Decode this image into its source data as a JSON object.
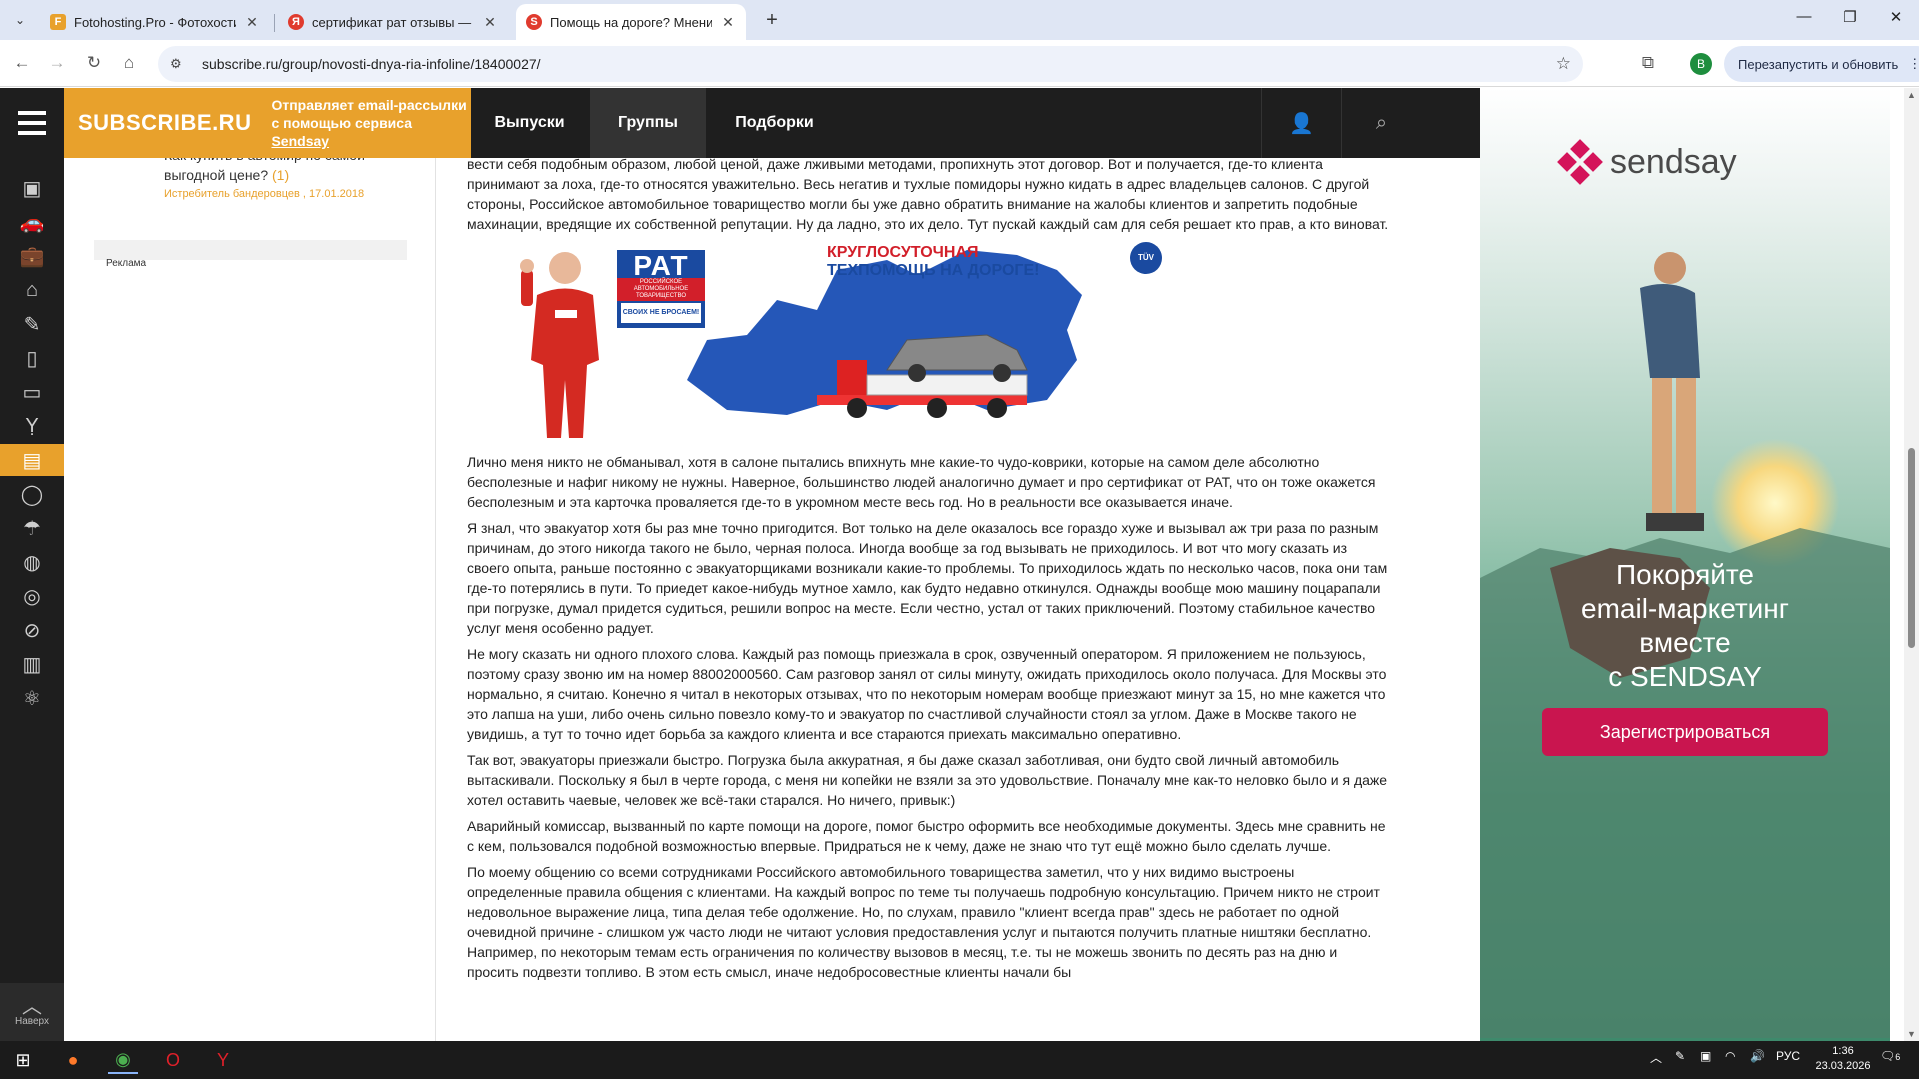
{
  "browser": {
    "tabs": [
      {
        "title": "Fotohosting.Pro - Фотохостинг",
        "favicon": "F",
        "color": "#e8a12c"
      },
      {
        "title": "сертификат рат отзывы — Янд",
        "favicon": "Я",
        "color": "#e03b2e"
      },
      {
        "title": "Помощь на дороге? Мнение п",
        "favicon": "S",
        "color": "#e03b2e"
      }
    ],
    "url": "subscribe.ru/group/novosti-dnya-ria-infoline/18400027/",
    "profile_initial": "В",
    "relaunch_label": "Перезапустить и обновить"
  },
  "site": {
    "brand": "SUBSCRIBE.RU",
    "tagline_1": "Отправляет email-рассылки",
    "tagline_2": "с помощью сервиса",
    "tagline_link": "Sendsay",
    "nav": [
      "Выпуски",
      "Группы",
      "Подборки"
    ],
    "scroll_top_label": "Наверх"
  },
  "left_column": {
    "question": "Как купить в автомир по самой выгодной цене?",
    "count": "(1)",
    "meta": "Истребитель бандеровцев , 17.01.2018",
    "ad_label": "Реклама"
  },
  "article": {
    "p0": "вести себя подобным образом, любой ценой, даже лживыми методами, пропихнуть этот договор. Вот и получается, где-то клиента принимают за лоха, где-то относятся уважительно. Весь негатив и тухлые помидоры нужно кидать в адрес владельцев салонов. С другой стороны, Российское автомобильное товарищество могли бы уже давно обратить внимание на жалобы клиентов и запретить подобные махинации, вредящие их собственной репутации. Ну да ладно, это их дело. Тут пускай каждый сам для себя решает кто прав, а кто виноват.",
    "banner": {
      "rat": "РАТ",
      "rat_sub": "РОССИЙСКОЕ АВТОМОБИЛЬНОЕ ТОВАРИЩЕСТВО",
      "slogan": "СВОИХ НЕ БРОСАЕМ!",
      "headline_1": "КРУГЛОСУТОЧНАЯ",
      "headline_2": "ТЕХПОМОЩЬ НА ДОРОГЕ!",
      "tuv": "TÜV"
    },
    "p1": "Лично меня никто не обманывал, хотя в салоне пытались впихнуть мне какие-то чудо-коврики, которые на самом деле абсолютно бесполезные и нафиг никому не нужны. Наверное, большинство людей аналогично думает и про сертификат от РАТ, что он тоже окажется бесполезным и эта карточка проваляется где-то в укромном месте весь год. Но в реальности все оказывается иначе.",
    "p2": "Я знал, что эвакуатор хотя бы раз мне точно пригодится. Вот только на деле оказалось все гораздо хуже и вызывал аж три раза по разным причинам, до этого никогда такого не было, черная полоса. Иногда вообще за год вызывать не приходилось. И вот что могу сказать из своего опыта, раньше постоянно с эвакуаторщиками возникали какие-то проблемы. То приходилось ждать по несколько часов, пока они там где-то потерялись в пути. То приедет какое-нибудь мутное хамло, как будто недавно откинулся. Однажды вообще мою машину поцарапали при погрузке, думал придется судиться, решили вопрос на месте. Если честно, устал от таких приключений. Поэтому стабильное качество услуг меня особенно радует.",
    "p3": "Не могу сказать ни одного плохого слова. Каждый раз помощь приезжала в срок, озвученный оператором. Я приложением не пользуюсь, поэтому сразу звоню им на номер 88002000560. Сам разговор занял от силы минуту, ожидать приходилось около получаса. Для Москвы это нормально, я считаю. Конечно я читал в некоторых отзывах, что по некоторым номерам вообще приезжают минут за 15, но мне кажется что это лапша на уши, либо очень сильно повезло кому-то и эвакуатор по счастливой случайности стоял за углом. Даже в Москве такого не увидишь, а тут то точно идет борьба за каждого клиента и все стараются приехать максимально оперативно.",
    "p4": "Так вот, эвакуаторы приезжали быстро. Погрузка была аккуратная, я бы даже сказал заботливая, они будто свой личный автомобиль вытаскивали. Поскольку я был в черте города, с меня ни копейки не взяли за это удовольствие. Поначалу мне как-то неловко было и я даже хотел оставить чаевые, человек же всё-таки старался. Но ничего, привык:)",
    "p5": "Аварийный комиссар, вызванный по карте помощи на дороге, помог быстро оформить все необходимые документы. Здесь мне сравнить не с кем, пользовался подобной возможностью впервые. Придраться не к чему, даже не знаю что тут ещё можно было сделать лучше.",
    "p6": "По моему общению со всеми сотрудниками Российского автомобильного товарищества заметил, что у них видимо выстроены определенные правила общения с клиентами. На каждый вопрос по теме ты получаешь подробную консультацию. Причем никто не строит недовольное выражение лица, типа делая тебе одолжение. Но, по слухам, правило \"клиент всегда прав\" здесь не работает по одной очевидной причине - слишком уж часто люди не читают условия предоставления услуг и пытаются получить платные ништяки бесплатно. Например, по некоторым темам есть ограничения по количеству вызовов в месяц, т.е. ты не можешь звонить по десять раз на дню и просить подвезти топливо. В этом есть смысл, иначе недобросовестные клиенты начали бы"
  },
  "ad": {
    "brand": "sendsay",
    "cta_1": "Покоряйте",
    "cta_2": "email-маркетинг",
    "cta_3": "вместе",
    "cta_4": "с SENDSAY",
    "button": "Зарегистрироваться"
  },
  "taskbar": {
    "lang": "РУС",
    "time": "1:36",
    "date": "23.03.2026",
    "notifications": "6"
  }
}
